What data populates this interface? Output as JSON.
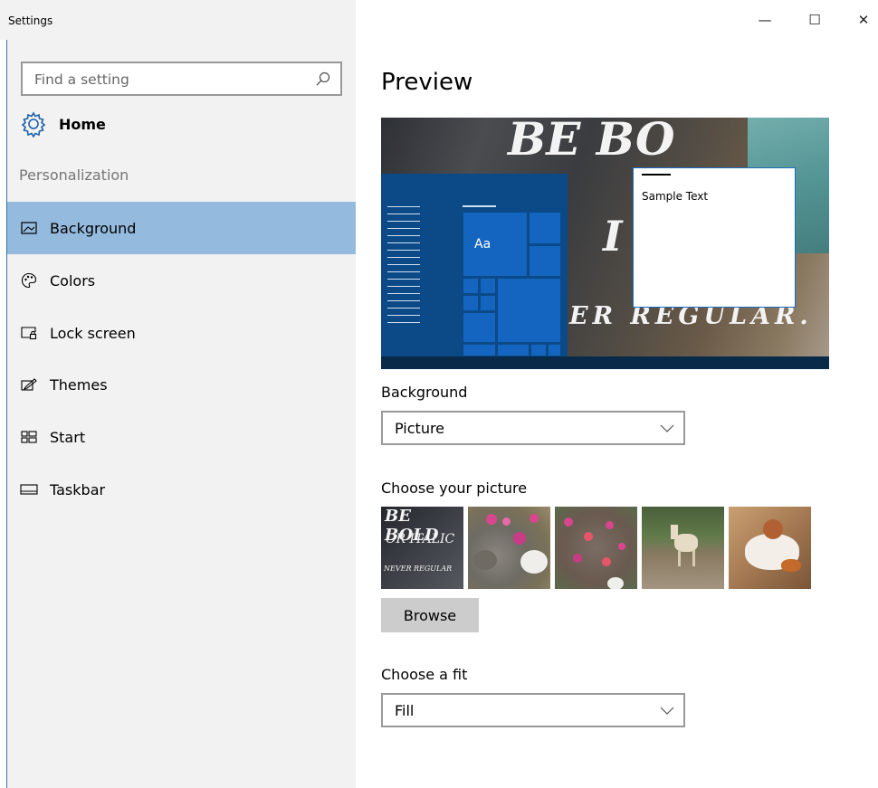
{
  "window": {
    "title": "Settings",
    "minimize_glyph": "—",
    "maximize_glyph": "☐",
    "close_glyph": "✕"
  },
  "sidebar": {
    "search": {
      "placeholder": "Find a setting",
      "icon": "search-icon"
    },
    "home": {
      "label": "Home",
      "icon": "gear-icon"
    },
    "section_title": "Personalization",
    "items": [
      {
        "label": "Background",
        "icon": "picture-icon",
        "selected": true
      },
      {
        "label": "Colors",
        "icon": "palette-icon",
        "selected": false
      },
      {
        "label": "Lock screen",
        "icon": "lock-screen-icon",
        "selected": false
      },
      {
        "label": "Themes",
        "icon": "themes-icon",
        "selected": false
      },
      {
        "label": "Start",
        "icon": "start-icon",
        "selected": false
      },
      {
        "label": "Taskbar",
        "icon": "taskbar-icon",
        "selected": false
      }
    ]
  },
  "main": {
    "preview_heading": "Preview",
    "preview": {
      "tile_label": "Aa",
      "window_text": "Sample Text",
      "wallpaper_text": [
        "BE BO",
        "I",
        "ER REGULAR."
      ]
    },
    "background": {
      "label": "Background",
      "value": "Picture"
    },
    "choose_picture": {
      "label": "Choose your picture",
      "thumb1_text": [
        "BE BOLD",
        "OR ITALIC",
        "NEVER REGULAR"
      ],
      "browse_label": "Browse"
    },
    "fit": {
      "label": "Choose a fit",
      "value": "Fill"
    }
  },
  "colors": {
    "selected_bg": "#94bbde",
    "sidebar_bg": "#f2f2f2",
    "start_menu": "#0b4a87",
    "tile": "#1465bf",
    "accent_border": "#3a6ea5"
  }
}
